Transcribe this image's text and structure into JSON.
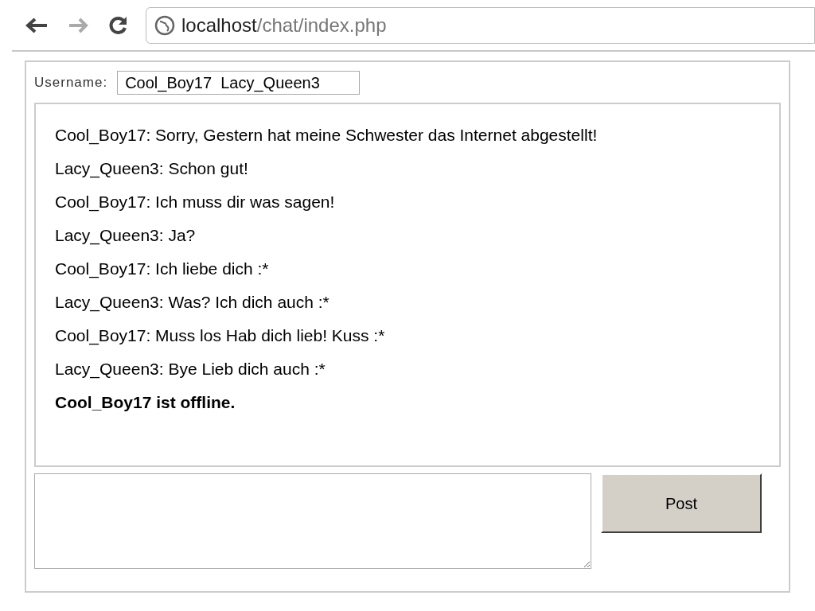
{
  "browser": {
    "url_host": "localhost",
    "url_path": "/chat/index.php"
  },
  "username": {
    "label": "Username:",
    "value": "Cool_Boy17  Lacy_Queen3"
  },
  "messages": [
    {
      "kind": "message",
      "text": "Cool_Boy17: Sorry, Gestern hat meine Schwester das Internet abgestellt!"
    },
    {
      "kind": "message",
      "text": "Lacy_Queen3: Schon gut!"
    },
    {
      "kind": "message",
      "text": "Cool_Boy17: Ich muss dir was sagen!"
    },
    {
      "kind": "message",
      "text": "Lacy_Queen3: Ja?"
    },
    {
      "kind": "message",
      "text": "Cool_Boy17: Ich liebe dich :*"
    },
    {
      "kind": "message",
      "text": "Lacy_Queen3: Was? Ich dich auch :*"
    },
    {
      "kind": "message",
      "text": "Cool_Boy17: Muss los Hab dich lieb! Kuss :*"
    },
    {
      "kind": "message",
      "text": "Lacy_Queen3: Bye Lieb dich auch :*"
    },
    {
      "kind": "status",
      "text": "Cool_Boy17 ist offline."
    }
  ],
  "post_button": "Post"
}
